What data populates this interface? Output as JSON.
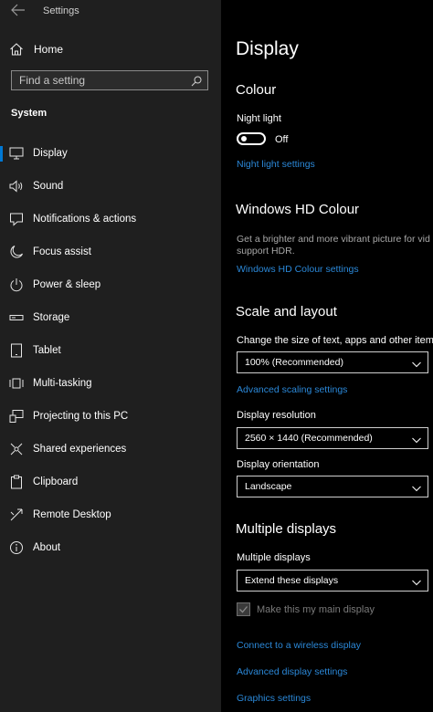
{
  "app": {
    "title": "Settings"
  },
  "sidebar": {
    "home_label": "Home",
    "search_placeholder": "Find a setting",
    "section_label": "System",
    "items": [
      {
        "label": "Display",
        "icon": "monitor-icon",
        "selected": true
      },
      {
        "label": "Sound",
        "icon": "speaker-icon"
      },
      {
        "label": "Notifications & actions",
        "icon": "notification-icon"
      },
      {
        "label": "Focus assist",
        "icon": "moon-icon"
      },
      {
        "label": "Power & sleep",
        "icon": "power-icon"
      },
      {
        "label": "Storage",
        "icon": "storage-icon"
      },
      {
        "label": "Tablet",
        "icon": "tablet-icon"
      },
      {
        "label": "Multi-tasking",
        "icon": "multitasking-icon"
      },
      {
        "label": "Projecting to this PC",
        "icon": "projecting-icon"
      },
      {
        "label": "Shared experiences",
        "icon": "shared-experiences-icon"
      },
      {
        "label": "Clipboard",
        "icon": "clipboard-icon"
      },
      {
        "label": "Remote Desktop",
        "icon": "remote-desktop-icon"
      },
      {
        "label": "About",
        "icon": "info-icon"
      }
    ]
  },
  "main": {
    "page_title": "Display",
    "colour": {
      "heading": "Colour",
      "night_light_label": "Night light",
      "night_light_state": "Off",
      "night_light_link": "Night light settings"
    },
    "hd_colour": {
      "heading": "Windows HD Colour",
      "description_line1": "Get a brighter and more vibrant picture for vid",
      "description_line2": "support HDR.",
      "link": "Windows HD Colour settings"
    },
    "scale_layout": {
      "heading": "Scale and layout",
      "scale_label": "Change the size of text, apps and other items",
      "scale_value": "100% (Recommended)",
      "advanced_scaling_link": "Advanced scaling settings",
      "resolution_label": "Display resolution",
      "resolution_value": "2560 × 1440 (Recommended)",
      "orientation_label": "Display orientation",
      "orientation_value": "Landscape"
    },
    "multiple_displays": {
      "heading": "Multiple displays",
      "label": "Multiple displays",
      "value": "Extend these displays",
      "main_display_checkbox": "Make this my main display",
      "main_display_checked": true,
      "wireless_link": "Connect to a wireless display",
      "advanced_display_link": "Advanced display settings",
      "graphics_link": "Graphics settings"
    }
  },
  "colors": {
    "accent": "#0078d4",
    "link": "#2b88d8",
    "sidebar_bg": "#1f1f1f",
    "main_bg": "#000000"
  }
}
